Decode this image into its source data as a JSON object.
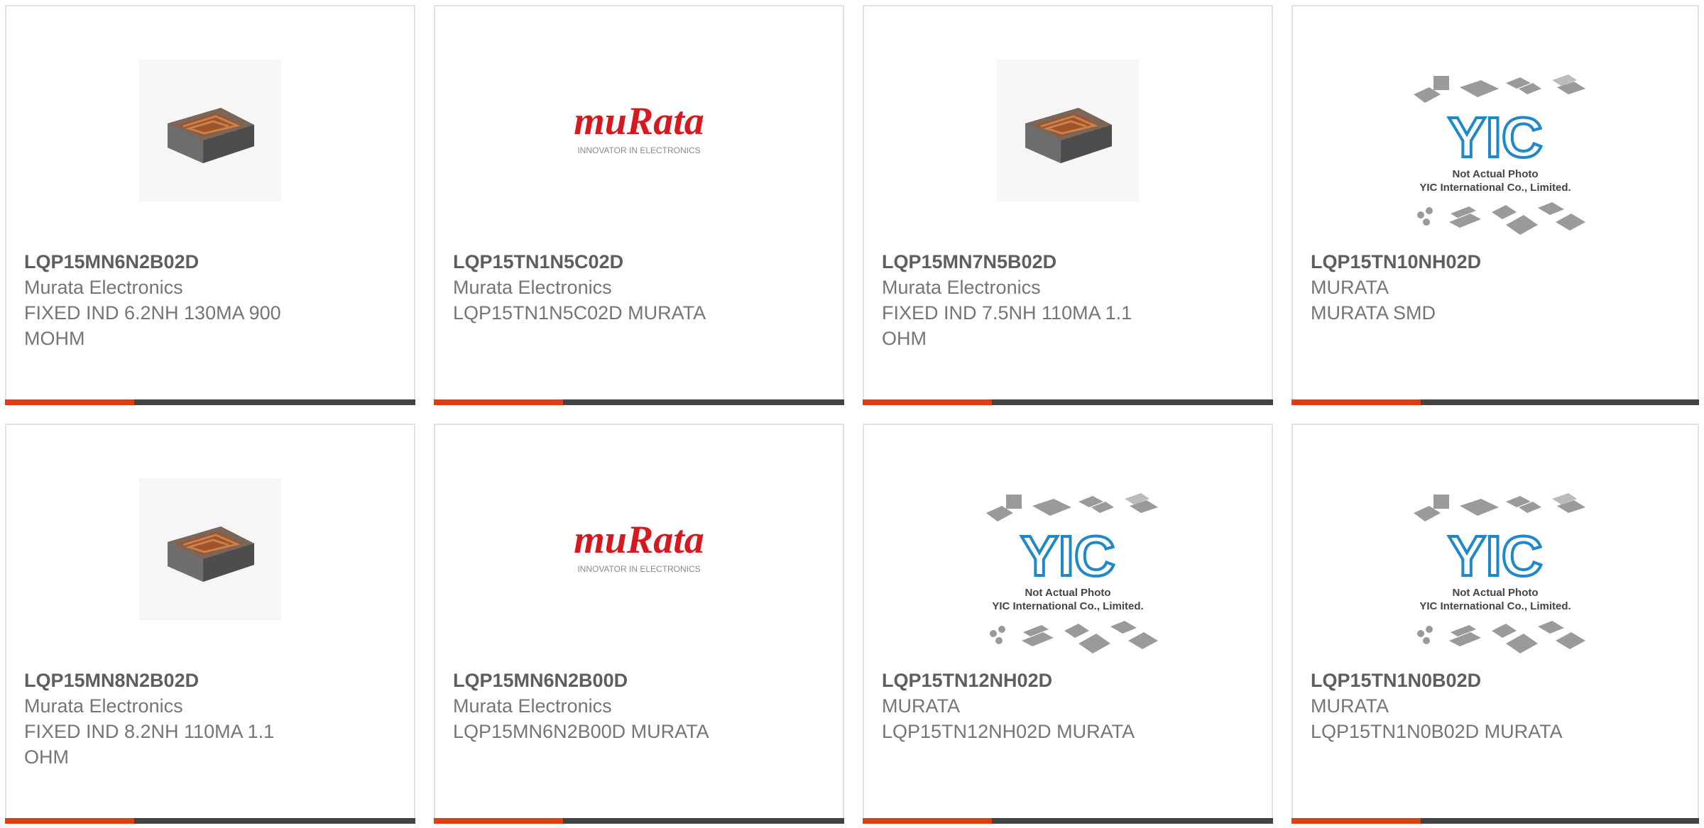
{
  "colors": {
    "accent": "#e03c13",
    "bar": "#434343",
    "murata_red": "#d7191f",
    "yic_blue": "#1e88c8"
  },
  "cards": [
    {
      "part": "LQP15MN6N2B02D",
      "manufacturer": "Murata Electronics",
      "description": "FIXED IND 6.2NH 130MA 900 MOHM",
      "image": "chip-inductor-photo"
    },
    {
      "part": "LQP15TN1N5C02D",
      "manufacturer": "Murata Electronics",
      "description": "LQP15TN1N5C02D MURATA",
      "image": "murata-logo",
      "logo_text": "muRata",
      "logo_tagline": "INNOVATOR IN ELECTRONICS"
    },
    {
      "part": "LQP15MN7N5B02D",
      "manufacturer": "Murata Electronics",
      "description": "FIXED IND 7.5NH 110MA 1.1 OHM",
      "image": "chip-inductor-photo"
    },
    {
      "part": "LQP15TN10NH02D",
      "manufacturer": "MURATA",
      "description": "MURATA SMD",
      "image": "yic-placeholder",
      "logo_text": "YIC",
      "note1": "Not Actual Photo",
      "note2": "YIC International Co., Limited."
    },
    {
      "part": "LQP15MN8N2B02D",
      "manufacturer": "Murata Electronics",
      "description": "FIXED IND 8.2NH 110MA 1.1 OHM",
      "image": "chip-inductor-photo"
    },
    {
      "part": "LQP15MN6N2B00D",
      "manufacturer": "Murata Electronics",
      "description": "LQP15MN6N2B00D MURATA",
      "image": "murata-logo",
      "logo_text": "muRata",
      "logo_tagline": "INNOVATOR IN ELECTRONICS"
    },
    {
      "part": "LQP15TN12NH02D",
      "manufacturer": "MURATA",
      "description": "LQP15TN12NH02D MURATA",
      "image": "yic-placeholder",
      "logo_text": "YIC",
      "note1": "Not Actual Photo",
      "note2": "YIC International Co., Limited."
    },
    {
      "part": "LQP15TN1N0B02D",
      "manufacturer": "MURATA",
      "description": "LQP15TN1N0B02D MURATA",
      "image": "yic-placeholder",
      "logo_text": "YIC",
      "note1": "Not Actual Photo",
      "note2": "YIC International Co., Limited."
    }
  ]
}
